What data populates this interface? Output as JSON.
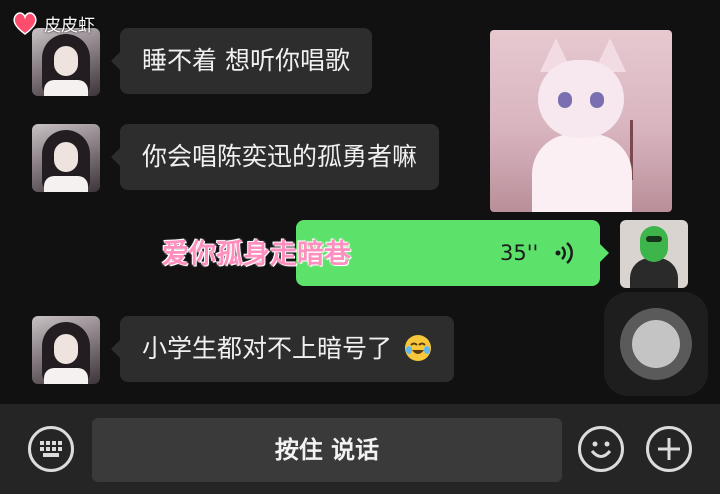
{
  "watermark": {
    "text": "皮皮虾",
    "icon": "shrimp-logo-icon"
  },
  "messages": [
    {
      "text": "睡不着 想听你唱歌"
    },
    {
      "text": "你会唱陈奕迅的孤勇者嘛"
    },
    {
      "text": "小学生都对不上暗号了",
      "emoji": "crying-laughing-emoji-icon"
    }
  ],
  "voice_message": {
    "duration": "35''",
    "icon": "voice-wave-icon"
  },
  "overlay_caption": "爱你孤身走暗巷",
  "input_bar": {
    "keyboard_icon": "keyboard-icon",
    "talk_label": "按住 说话",
    "emoji_icon": "emoji-icon",
    "plus_icon": "plus-icon"
  },
  "colors": {
    "bubble": "#2d2d2d",
    "voice_bubble": "#5ce26a",
    "caption": "#ff8fbf"
  }
}
